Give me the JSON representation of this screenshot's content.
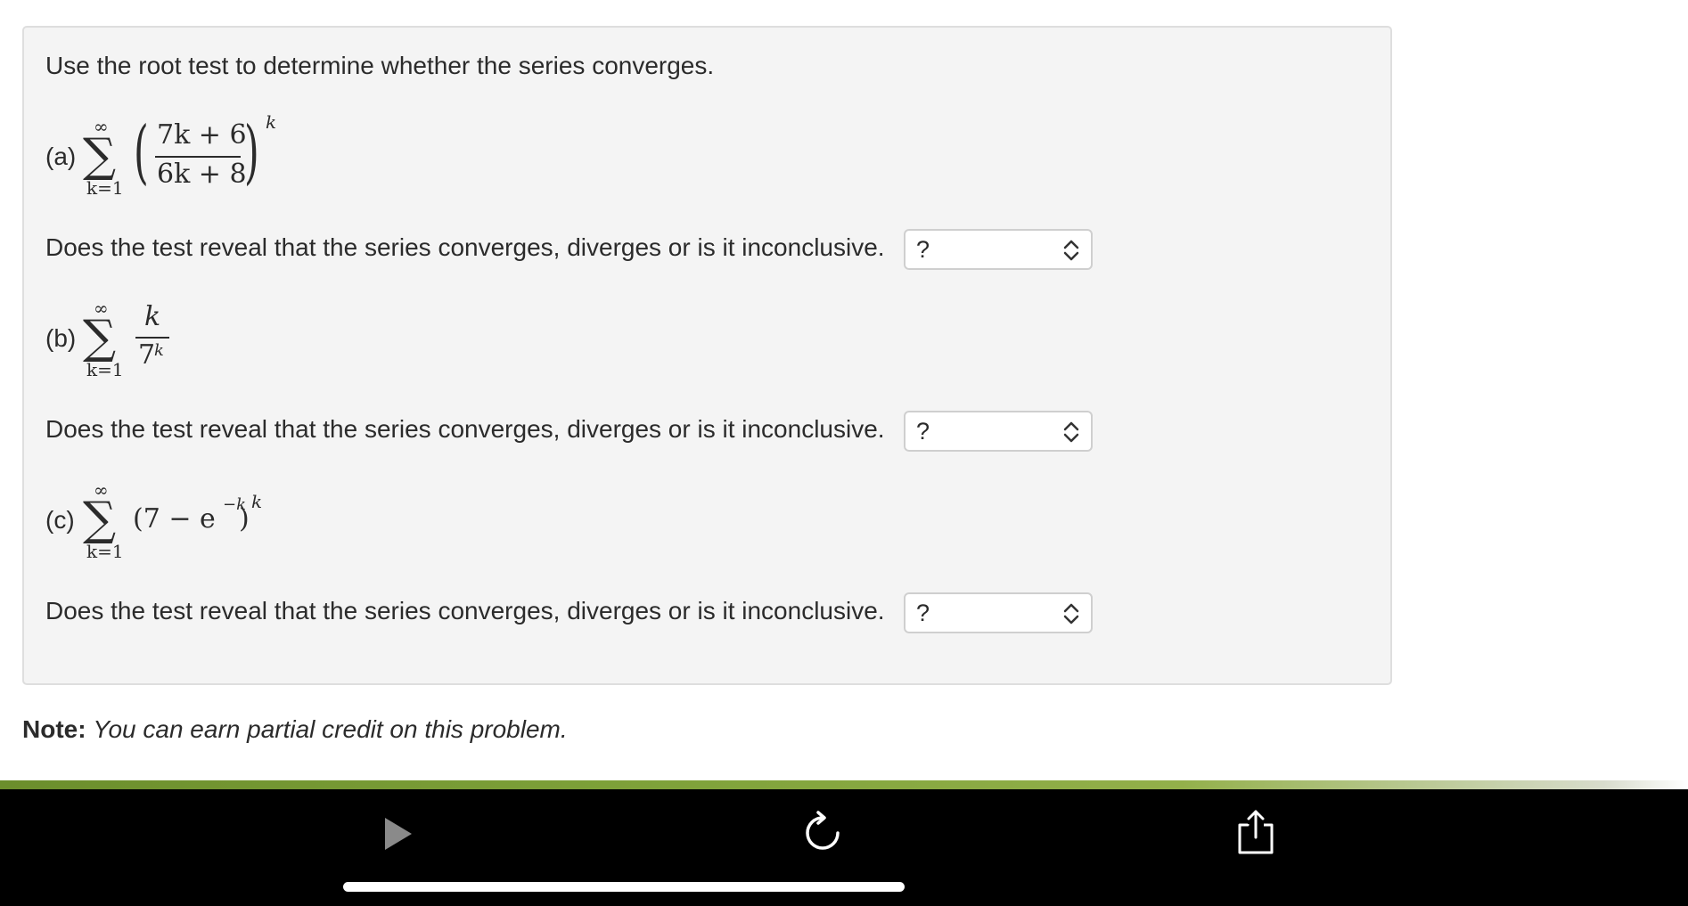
{
  "prompt": "Use the root test to determine whether the series converges.",
  "question_text": "Does the test reveal that the series converges, diverges or is it inconclusive.",
  "parts": [
    {
      "label": "(a)",
      "sum_upper": "∞",
      "sum_lower": "k=1",
      "numerator": "7k + 6",
      "denominator": "6k + 8",
      "exponent": "k",
      "selected": "?"
    },
    {
      "label": "(b)",
      "sum_upper": "∞",
      "sum_lower": "k=1",
      "numerator": "k",
      "denominator_base": "7",
      "denominator_exp": "k",
      "selected": "?"
    },
    {
      "label": "(c)",
      "sum_upper": "∞",
      "sum_lower": "k=1",
      "base": "(7 − e",
      "inner_exp": "−k",
      "close": ")",
      "exponent": "k",
      "selected": "?"
    }
  ],
  "note": {
    "bold": "Note:",
    "italic": "You can earn partial credit on this problem."
  },
  "controls": {
    "play_icon": "play-icon",
    "reload_icon": "reload-icon",
    "share_icon": "share-icon"
  },
  "colors": {
    "accent_bar": "#7fa23a",
    "panel_bg": "#f4f4f4"
  }
}
